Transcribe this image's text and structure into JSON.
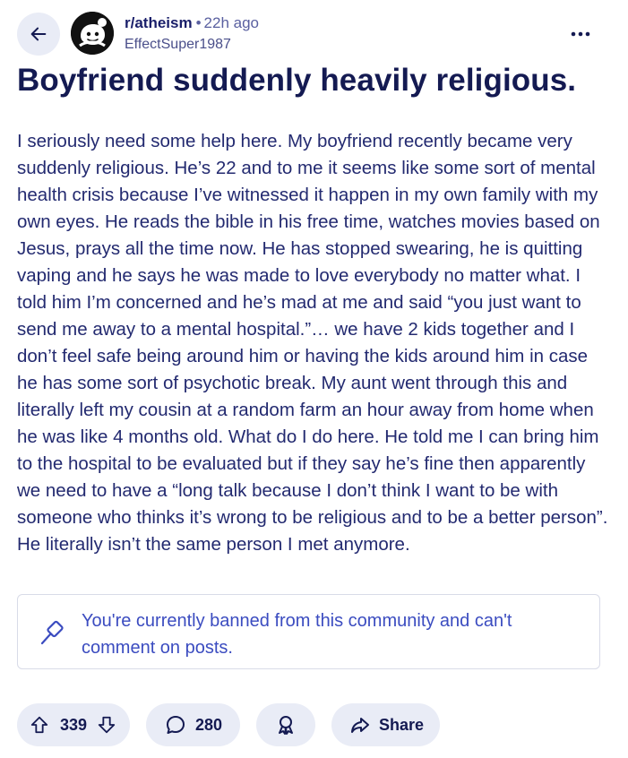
{
  "header": {
    "subreddit": "r/atheism",
    "separator": "•",
    "time_ago": "22h ago",
    "author": "EffectSuper1987"
  },
  "post": {
    "title": "Boyfriend suddenly heavily religious.",
    "body": "I seriously need some help here. My boyfriend recently became very suddenly religious. He’s 22 and to me it seems like some sort of mental health crisis because I’ve witnessed it happen in my own family with my own eyes. He reads the bible in his free time, watches movies based on Jesus, prays all the time now. He has stopped swearing, he is quitting vaping and he says he was made to love everybody no matter what. I told him I’m concerned and he’s mad at me and said “you just want to send me away to a mental hospital.”… we have 2 kids together and I don’t feel safe being around him or having the kids around him in case he has some sort of psychotic break. My aunt went through this and literally left my cousin at a random farm an hour away from home when he was like 4 months old. What do I do here. He told me I can bring him to the hospital to be evaluated but if they say he’s fine then apparently we need to have a “long talk because I don’t think I want to be with someone who thinks it’s wrong to be religious and to be a better person”. He literally isn’t the same person I met anymore."
  },
  "banned_notice": {
    "icon": "hammer-icon",
    "message": "You're currently banned from this community and can't comment on posts."
  },
  "actions": {
    "vote_count": "339",
    "comment_count": "280",
    "share_label": "Share"
  },
  "colors": {
    "pill_background": "#e9ecf6",
    "banned_text": "#3b4cc0",
    "title_text": "#141a52"
  }
}
